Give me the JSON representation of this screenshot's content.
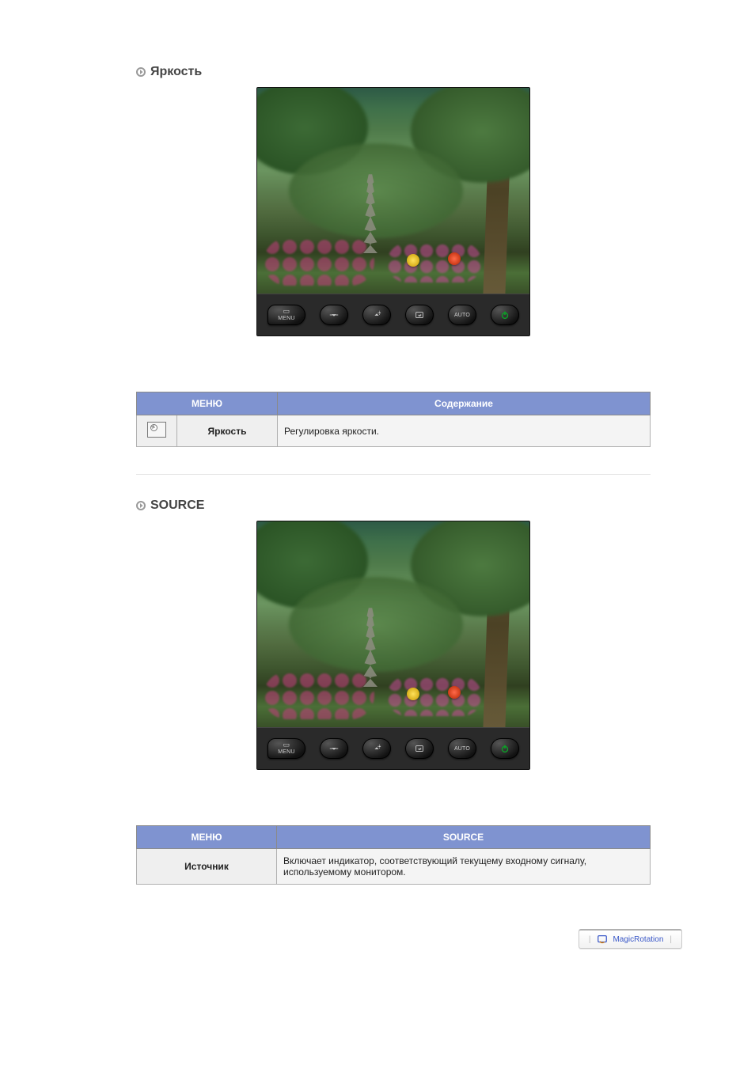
{
  "sections": {
    "brightness": {
      "heading": "Яркость",
      "table": {
        "menu_header": "МЕНЮ",
        "content_header": "Содержание",
        "row_label": "Яркость",
        "row_desc": "Регулировка яркости."
      }
    },
    "source": {
      "heading": "SOURCE",
      "table": {
        "menu_header": "МЕНЮ",
        "content_header": "SOURCE",
        "row_label": "Источник",
        "row_desc": "Включает индикатор, соответствующий текущему входному сигналу, используемому монитором."
      }
    }
  },
  "monitor_buttons": {
    "menu": "MENU",
    "down": "▾",
    "up_bright": "☼",
    "enter": "⏎",
    "auto": "AUTO",
    "power": "⏻"
  },
  "footer": {
    "magic_rotation": "MagicRotation"
  }
}
